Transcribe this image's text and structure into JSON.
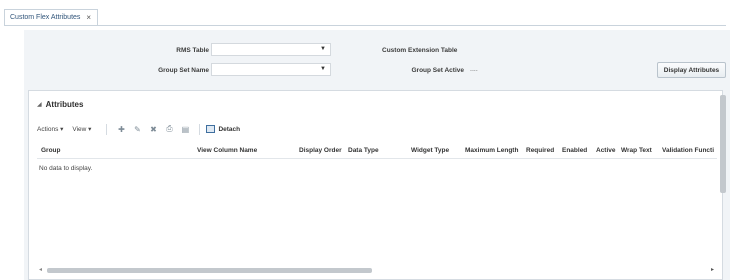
{
  "tabs": [
    {
      "label": "Custom Flex Attributes",
      "close_glyph": "×"
    }
  ],
  "criteria": {
    "rms_table_label": "RMS Table",
    "group_set_name_label": "Group Set Name",
    "custom_extension_table_label": "Custom Extension Table",
    "group_set_active_label": "Group Set Active",
    "group_set_active_value": "....",
    "dropdown_arrow": "▼",
    "display_attributes_button": "Display Attributes"
  },
  "attributes_panel": {
    "collapse_glyph": "◢",
    "title": "Attributes",
    "toolbar": {
      "actions_label": "Actions ▾",
      "view_label": "View ▾",
      "detach_label": "Detach"
    },
    "columns": [
      "Group",
      "View Column Name",
      "Display Order",
      "Data Type",
      "Widget Type",
      "Maximum Length",
      "Required",
      "Enabled",
      "Active",
      "Wrap Text",
      "Validation Functi"
    ],
    "empty_message": "No data to display."
  }
}
